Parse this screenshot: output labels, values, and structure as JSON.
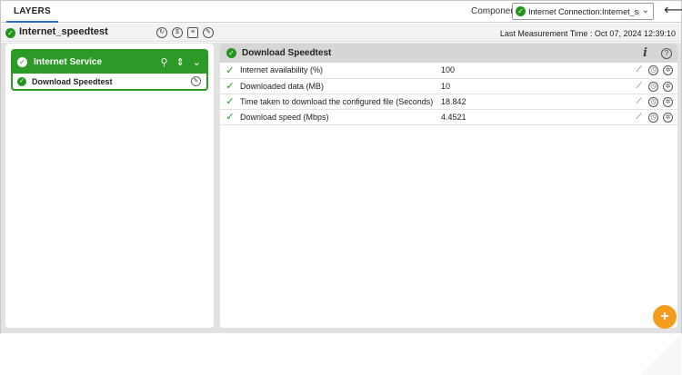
{
  "topbar": {
    "tab_label": "LAYERS",
    "component_label": "Component",
    "component_value": "Internet Connection:Internet_speedtest"
  },
  "header": {
    "title": "Internet_speedtest",
    "last_measurement": "Last Measurement Time : Oct 07, 2024 12:39:10"
  },
  "left": {
    "service_name": "Internet Service",
    "items": [
      {
        "label": "Download Speedtest"
      }
    ]
  },
  "right": {
    "title": "Download Speedtest",
    "rows": [
      {
        "name": "Internet availability (%)",
        "value": "100"
      },
      {
        "name": "Downloaded data (MB)",
        "value": "10"
      },
      {
        "name": "Time taken to download the configured file (Seconds)",
        "value": "18.842"
      },
      {
        "name": "Download speed (Mbps)",
        "value": "4.4521"
      }
    ]
  },
  "colors": {
    "ok_green": "#23951f",
    "service_green": "#2b9a26",
    "zoom_orange": "#f39c1e"
  },
  "icons": [
    "check-circle-icon",
    "back-arrow-icon",
    "search-icon",
    "collapse-icon",
    "chevron-down-icon",
    "wrench-icon",
    "info-icon",
    "help-icon",
    "trend-chart-icon",
    "history-icon",
    "settings-icon",
    "zoom-in-icon"
  ]
}
